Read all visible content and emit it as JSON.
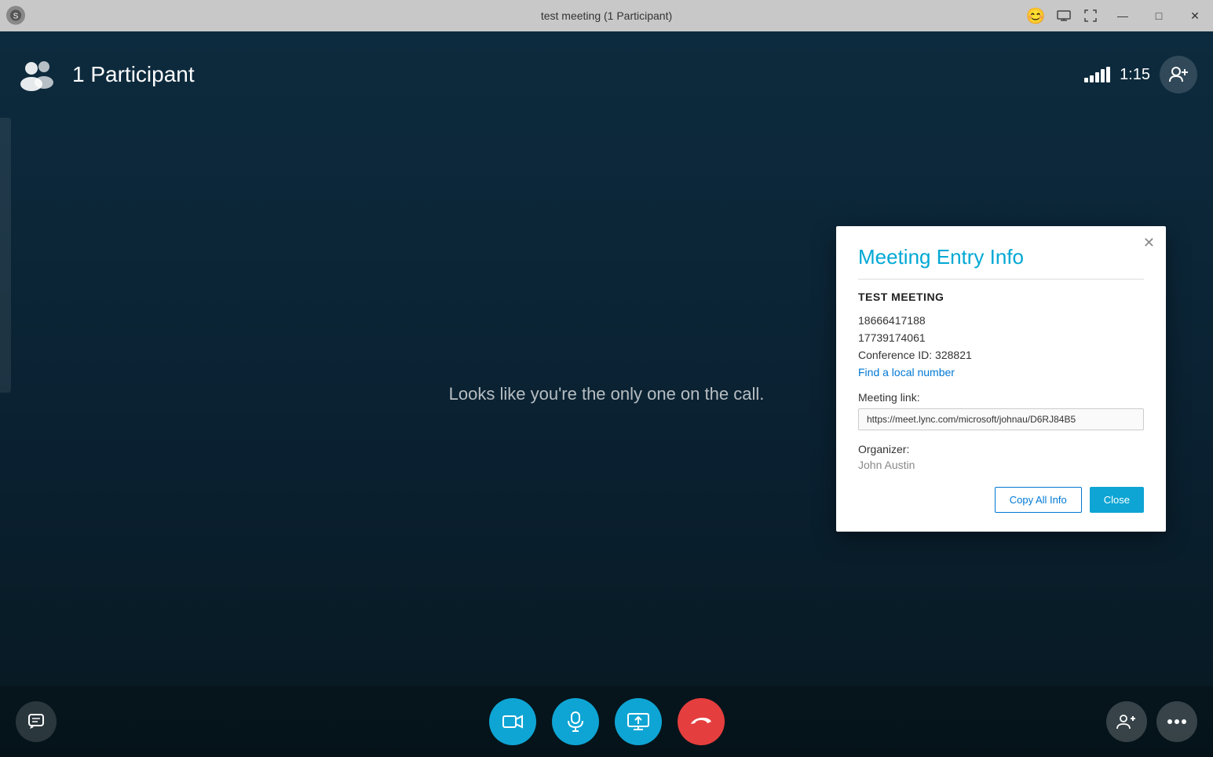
{
  "titleBar": {
    "title": "test meeting (1 Participant)",
    "emoji": "😊",
    "controls": [
      "minimize",
      "restore",
      "close"
    ]
  },
  "topBar": {
    "participantCount": "1 Participant",
    "timer": "1:15"
  },
  "centerMessage": {
    "text": "Looks like you're the only one on the call."
  },
  "modal": {
    "title": "Meeting Entry Info",
    "meetingName": "TEST MEETING",
    "phoneNumbers": [
      "18666417188",
      "17739174061"
    ],
    "conferenceId": "Conference ID: 328821",
    "findLocalLink": "Find a local number",
    "meetingLinkLabel": "Meeting link:",
    "meetingLinkUrl": "https://meet.lync.com/microsoft/johnau/D6RJ84B5",
    "organizerLabel": "Organizer:",
    "organizerName": "John Austin",
    "copyAllLabel": "Copy All Info",
    "closeLabel": "Close"
  },
  "bottomBar": {
    "chatLabel": "💬",
    "videoLabel": "📷",
    "micLabel": "🎤",
    "screenLabel": "🖥",
    "hangupLabel": "📞",
    "manageLabel": "👤",
    "moreLabel": "···"
  }
}
